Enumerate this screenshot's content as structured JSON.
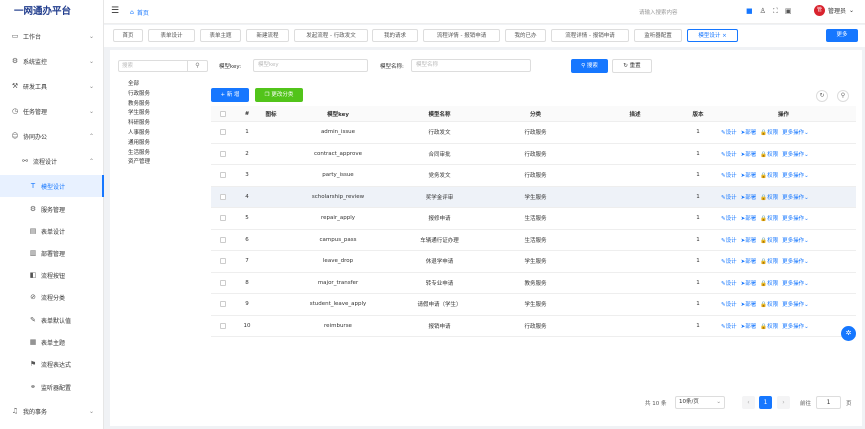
{
  "app": {
    "title": "一网通办平台"
  },
  "header": {
    "home_label": "首页",
    "search_placeholder": "请输入搜索内容",
    "user_name": "管理员",
    "avatar_text": "管"
  },
  "sidebar": {
    "items": [
      {
        "label": "工作台",
        "icon": "monitor-icon",
        "arrow": "⌄"
      },
      {
        "label": "系统监控",
        "icon": "gear-icon",
        "arrow": "⌄"
      },
      {
        "label": "研发工具",
        "icon": "tool-icon",
        "arrow": "⌄"
      },
      {
        "label": "任务管理",
        "icon": "clock-icon",
        "arrow": "⌄"
      },
      {
        "label": "协同办公",
        "icon": "people-icon",
        "arrow": "⌃"
      },
      {
        "label": "流程设计",
        "icon": "flow-icon",
        "arrow": "⌃"
      },
      {
        "label": "模型设计",
        "icon": "type-icon",
        "active": true
      },
      {
        "label": "服务管理",
        "icon": "gear-icon"
      },
      {
        "label": "表单设计",
        "icon": "form-icon"
      },
      {
        "label": "部署管理",
        "icon": "deploy-icon"
      },
      {
        "label": "流程按钮",
        "icon": "button-icon"
      },
      {
        "label": "流程分类",
        "icon": "category-icon"
      },
      {
        "label": "表单默认值",
        "icon": "pen-icon"
      },
      {
        "label": "表单主题",
        "icon": "theme-icon"
      },
      {
        "label": "流程表达式",
        "icon": "flag-icon"
      },
      {
        "label": "监听器配置",
        "icon": "link-icon"
      },
      {
        "label": "我的事务",
        "icon": "bell-icon",
        "arrow": "⌄"
      }
    ]
  },
  "tabs": [
    {
      "label": "首页"
    },
    {
      "label": "表单设计"
    },
    {
      "label": "表单主题"
    },
    {
      "label": "新建流程"
    },
    {
      "label": "发起流程 - 行政发文"
    },
    {
      "label": "我的请求"
    },
    {
      "label": "流程详情 - 报销申请"
    },
    {
      "label": "我的已办"
    },
    {
      "label": "流程详情 - 报销申请"
    },
    {
      "label": "监听器配置"
    },
    {
      "label": "模型设计",
      "active": true
    }
  ],
  "more_label": "更多",
  "tree": {
    "search_placeholder": "搜索",
    "items": [
      "全部",
      "行政服务",
      "教务服务",
      "学生服务",
      "科研服务",
      "人事服务",
      "通用服务",
      "生活服务",
      "资产管理"
    ]
  },
  "filters": {
    "key_label": "模型key:",
    "key_placeholder": "模型key",
    "name_label": "模型名称:",
    "name_placeholder": "模型名称",
    "search_btn": "搜索",
    "reset_btn": "重置"
  },
  "actions": {
    "add": "新 增",
    "change_category": "更改分类"
  },
  "table": {
    "headers": [
      "#",
      "图标",
      "模型key",
      "模型名称",
      "分类",
      "描述",
      "版本",
      "操作"
    ],
    "ops": [
      "设计",
      "部署",
      "权限",
      "更多操作"
    ],
    "rows": [
      {
        "no": "1",
        "key": "admin_issue",
        "name": "行政发文",
        "category": "行政服务",
        "desc": "",
        "version": "1"
      },
      {
        "no": "2",
        "key": "contract_approve",
        "name": "合同审批",
        "category": "行政服务",
        "desc": "",
        "version": "1"
      },
      {
        "no": "3",
        "key": "party_issue",
        "name": "党务发文",
        "category": "行政服务",
        "desc": "",
        "version": "1"
      },
      {
        "no": "4",
        "key": "scholarship_review",
        "name": "奖学金评审",
        "category": "学生服务",
        "desc": "",
        "version": "1"
      },
      {
        "no": "5",
        "key": "repair_apply",
        "name": "报修申请",
        "category": "生活服务",
        "desc": "",
        "version": "1"
      },
      {
        "no": "6",
        "key": "campus_pass",
        "name": "车辆通行证办理",
        "category": "生活服务",
        "desc": "",
        "version": "1"
      },
      {
        "no": "7",
        "key": "leave_drop",
        "name": "休退学申请",
        "category": "学生服务",
        "desc": "",
        "version": "1"
      },
      {
        "no": "8",
        "key": "major_transfer",
        "name": "转专业申请",
        "category": "教务服务",
        "desc": "",
        "version": "1"
      },
      {
        "no": "9",
        "key": "student_leave_apply",
        "name": "请假申请（学生）",
        "category": "学生服务",
        "desc": "",
        "version": "1"
      },
      {
        "no": "10",
        "key": "reimburse",
        "name": "报销申请",
        "category": "行政服务",
        "desc": "",
        "version": "1"
      }
    ]
  },
  "pagination": {
    "total": "共 10 条",
    "page_size": "10条/页",
    "current": "1",
    "goto_label": "前往",
    "goto_value": "1",
    "page_suffix": "页"
  },
  "colors": {
    "primary": "#1677ff",
    "success": "#52c41a",
    "brand": "#1f3b8c"
  }
}
